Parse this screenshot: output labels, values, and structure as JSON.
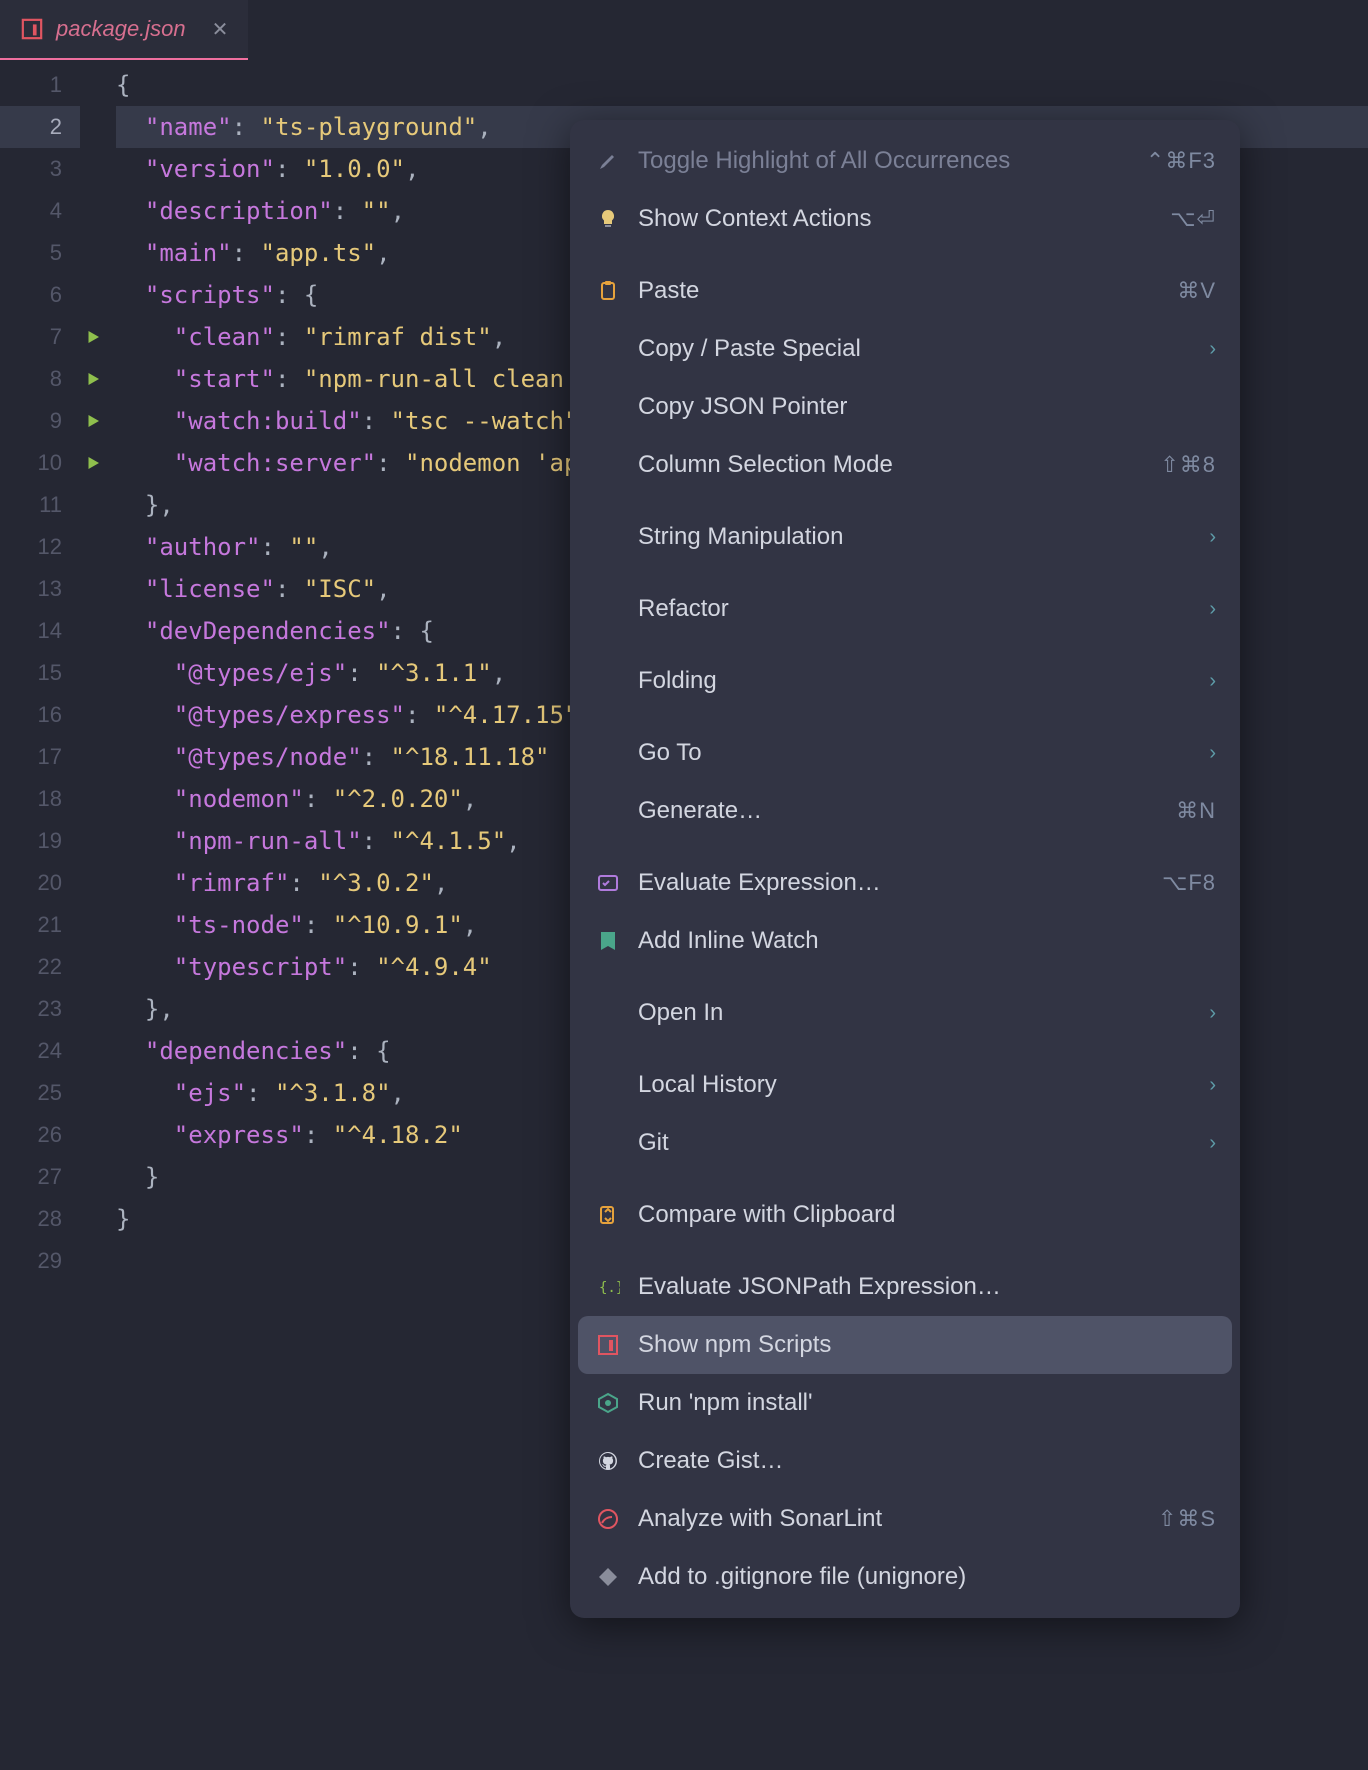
{
  "tab": {
    "filename": "package.json"
  },
  "code": {
    "lines": [
      {
        "num": 1,
        "tokens": [
          [
            "{",
            "punct"
          ]
        ]
      },
      {
        "num": 2,
        "selected": true,
        "tokens": [
          [
            "  ",
            "ws"
          ],
          [
            "\"name\"",
            "key"
          ],
          [
            ": ",
            "colon"
          ],
          [
            "\"ts-playground\"",
            "str"
          ],
          [
            ",",
            "punct"
          ]
        ]
      },
      {
        "num": 3,
        "tokens": [
          [
            "  ",
            "ws"
          ],
          [
            "\"version\"",
            "key"
          ],
          [
            ": ",
            "colon"
          ],
          [
            "\"1.0.0\"",
            "str"
          ],
          [
            ",",
            "punct"
          ]
        ]
      },
      {
        "num": 4,
        "tokens": [
          [
            "  ",
            "ws"
          ],
          [
            "\"description\"",
            "key"
          ],
          [
            ": ",
            "colon"
          ],
          [
            "\"\"",
            "str"
          ],
          [
            ",",
            "punct"
          ]
        ]
      },
      {
        "num": 5,
        "tokens": [
          [
            "  ",
            "ws"
          ],
          [
            "\"main\"",
            "key"
          ],
          [
            ": ",
            "colon"
          ],
          [
            "\"app.ts\"",
            "str"
          ],
          [
            ",",
            "punct"
          ]
        ]
      },
      {
        "num": 6,
        "tokens": [
          [
            "  ",
            "ws"
          ],
          [
            "\"scripts\"",
            "key"
          ],
          [
            ": ",
            "colon"
          ],
          [
            "{",
            "punct"
          ]
        ]
      },
      {
        "num": 7,
        "run": true,
        "tokens": [
          [
            "    ",
            "ws"
          ],
          [
            "\"clean\"",
            "key"
          ],
          [
            ": ",
            "colon"
          ],
          [
            "\"rimraf dist\"",
            "str"
          ],
          [
            ",",
            "punct"
          ]
        ]
      },
      {
        "num": 8,
        "run": true,
        "tokens": [
          [
            "    ",
            "ws"
          ],
          [
            "\"start\"",
            "key"
          ],
          [
            ": ",
            "colon"
          ],
          [
            "\"npm-run-all clean                         l\"",
            "str"
          ],
          [
            ",",
            "punct"
          ]
        ]
      },
      {
        "num": 9,
        "run": true,
        "tokens": [
          [
            "    ",
            "ws"
          ],
          [
            "\"watch:build\"",
            "key"
          ],
          [
            ": ",
            "colon"
          ],
          [
            "\"tsc --watch\"",
            "str"
          ]
        ]
      },
      {
        "num": 10,
        "run": true,
        "tokens": [
          [
            "    ",
            "ws"
          ],
          [
            "\"watch:server\"",
            "key"
          ],
          [
            ": ",
            "colon"
          ],
          [
            "\"nodemon 'ap                        outer'\"",
            "str"
          ]
        ]
      },
      {
        "num": 11,
        "tokens": [
          [
            "  ",
            "ws"
          ],
          [
            "},",
            "punct"
          ]
        ]
      },
      {
        "num": 12,
        "tokens": [
          [
            "  ",
            "ws"
          ],
          [
            "\"author\"",
            "key"
          ],
          [
            ": ",
            "colon"
          ],
          [
            "\"\"",
            "str"
          ],
          [
            ",",
            "punct"
          ]
        ]
      },
      {
        "num": 13,
        "tokens": [
          [
            "  ",
            "ws"
          ],
          [
            "\"license\"",
            "key"
          ],
          [
            ": ",
            "colon"
          ],
          [
            "\"ISC\"",
            "str"
          ],
          [
            ",",
            "punct"
          ]
        ]
      },
      {
        "num": 14,
        "tokens": [
          [
            "  ",
            "ws"
          ],
          [
            "\"devDependencies\"",
            "key"
          ],
          [
            ": ",
            "colon"
          ],
          [
            "{",
            "punct"
          ]
        ]
      },
      {
        "num": 15,
        "tokens": [
          [
            "    ",
            "ws"
          ],
          [
            "\"@types/ejs\"",
            "key"
          ],
          [
            ": ",
            "colon"
          ],
          [
            "\"^3.1.1\"",
            "str"
          ],
          [
            ",",
            "punct"
          ]
        ]
      },
      {
        "num": 16,
        "tokens": [
          [
            "    ",
            "ws"
          ],
          [
            "\"@types/express\"",
            "key"
          ],
          [
            ": ",
            "colon"
          ],
          [
            "\"^4.17.15\"",
            "str"
          ]
        ]
      },
      {
        "num": 17,
        "tokens": [
          [
            "    ",
            "ws"
          ],
          [
            "\"@types/node\"",
            "key"
          ],
          [
            ": ",
            "colon"
          ],
          [
            "\"^18.11.18\"",
            "str"
          ]
        ]
      },
      {
        "num": 18,
        "tokens": [
          [
            "    ",
            "ws"
          ],
          [
            "\"nodemon\"",
            "key"
          ],
          [
            ": ",
            "colon"
          ],
          [
            "\"^2.0.20\"",
            "str"
          ],
          [
            ",",
            "punct"
          ]
        ]
      },
      {
        "num": 19,
        "tokens": [
          [
            "    ",
            "ws"
          ],
          [
            "\"npm-run-all\"",
            "key"
          ],
          [
            ": ",
            "colon"
          ],
          [
            "\"^4.1.5\"",
            "str"
          ],
          [
            ",",
            "punct"
          ]
        ]
      },
      {
        "num": 20,
        "tokens": [
          [
            "    ",
            "ws"
          ],
          [
            "\"rimraf\"",
            "key"
          ],
          [
            ": ",
            "colon"
          ],
          [
            "\"^3.0.2\"",
            "str"
          ],
          [
            ",",
            "punct"
          ]
        ]
      },
      {
        "num": 21,
        "tokens": [
          [
            "    ",
            "ws"
          ],
          [
            "\"ts-node\"",
            "key"
          ],
          [
            ": ",
            "colon"
          ],
          [
            "\"^10.9.1\"",
            "str"
          ],
          [
            ",",
            "punct"
          ]
        ]
      },
      {
        "num": 22,
        "tokens": [
          [
            "    ",
            "ws"
          ],
          [
            "\"typescript\"",
            "key"
          ],
          [
            ": ",
            "colon"
          ],
          [
            "\"^4.9.4\"",
            "str"
          ]
        ]
      },
      {
        "num": 23,
        "tokens": [
          [
            "  ",
            "ws"
          ],
          [
            "},",
            "punct"
          ]
        ]
      },
      {
        "num": 24,
        "tokens": [
          [
            "  ",
            "ws"
          ],
          [
            "\"dependencies\"",
            "key"
          ],
          [
            ": ",
            "colon"
          ],
          [
            "{",
            "punct"
          ]
        ]
      },
      {
        "num": 25,
        "tokens": [
          [
            "    ",
            "ws"
          ],
          [
            "\"ejs\"",
            "key"
          ],
          [
            ": ",
            "colon"
          ],
          [
            "\"^3.1.8\"",
            "str"
          ],
          [
            ",",
            "punct"
          ]
        ]
      },
      {
        "num": 26,
        "tokens": [
          [
            "    ",
            "ws"
          ],
          [
            "\"express\"",
            "key"
          ],
          [
            ": ",
            "colon"
          ],
          [
            "\"^4.18.2\"",
            "str"
          ]
        ]
      },
      {
        "num": 27,
        "tokens": [
          [
            "  ",
            "ws"
          ],
          [
            "}",
            "punct"
          ]
        ]
      },
      {
        "num": 28,
        "tokens": [
          [
            "}",
            "punct"
          ]
        ]
      },
      {
        "num": 29,
        "tokens": []
      }
    ]
  },
  "menu": {
    "items": [
      {
        "icon": "highlighter",
        "label": "Toggle Highlight of All Occurrences",
        "shortcut": "⌃⌘F3",
        "disabled": true
      },
      {
        "icon": "bulb",
        "label": "Show Context Actions",
        "shortcut": "⌥⏎"
      },
      {
        "sep": true
      },
      {
        "icon": "clipboard",
        "label": "Paste",
        "shortcut": "⌘V"
      },
      {
        "icon": "",
        "label": "Copy / Paste Special",
        "sub": true
      },
      {
        "icon": "",
        "label": "Copy JSON Pointer"
      },
      {
        "icon": "",
        "label": "Column Selection Mode",
        "shortcut": "⇧⌘8"
      },
      {
        "sep": true
      },
      {
        "icon": "",
        "label": "String Manipulation",
        "sub": true
      },
      {
        "sep": true
      },
      {
        "icon": "",
        "label": "Refactor",
        "sub": true
      },
      {
        "sep": true
      },
      {
        "icon": "",
        "label": "Folding",
        "sub": true
      },
      {
        "sep": true
      },
      {
        "icon": "",
        "label": "Go To",
        "sub": true
      },
      {
        "icon": "",
        "label": "Generate…",
        "shortcut": "⌘N"
      },
      {
        "sep": true
      },
      {
        "icon": "eval",
        "label": "Evaluate Expression…",
        "shortcut": "⌥F8"
      },
      {
        "icon": "watch",
        "label": "Add Inline Watch"
      },
      {
        "sep": true
      },
      {
        "icon": "",
        "label": "Open In",
        "sub": true
      },
      {
        "sep": true
      },
      {
        "icon": "",
        "label": "Local History",
        "sub": true
      },
      {
        "icon": "",
        "label": "Git",
        "sub": true
      },
      {
        "sep": true
      },
      {
        "icon": "compare",
        "label": "Compare with Clipboard"
      },
      {
        "sep": true
      },
      {
        "icon": "jsonpath",
        "label": "Evaluate JSONPath Expression…"
      },
      {
        "icon": "npm",
        "label": "Show npm Scripts",
        "selected": true
      },
      {
        "icon": "install",
        "label": "Run 'npm install'"
      },
      {
        "icon": "github",
        "label": "Create Gist…"
      },
      {
        "icon": "sonar",
        "label": "Analyze with SonarLint",
        "shortcut": "⇧⌘S"
      },
      {
        "icon": "gitignore",
        "label": "Add to .gitignore file (unignore)"
      }
    ]
  }
}
